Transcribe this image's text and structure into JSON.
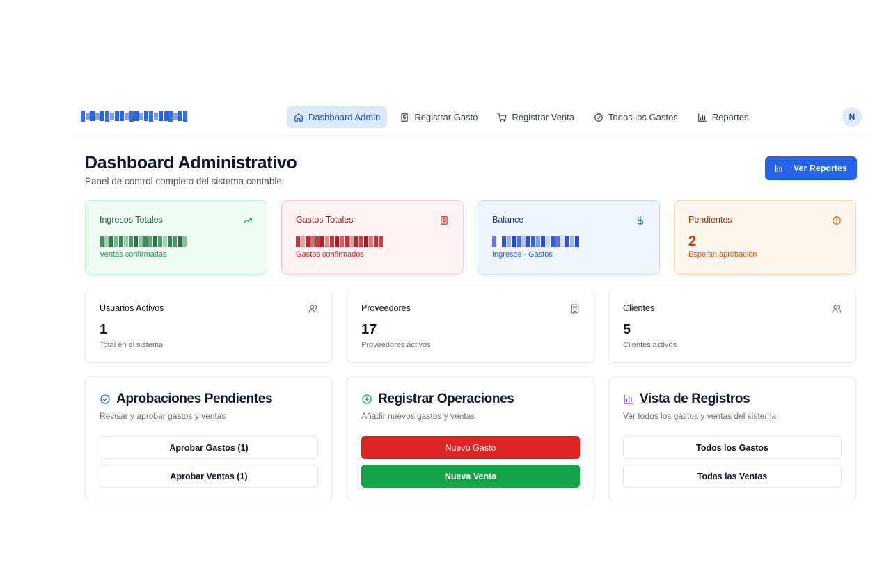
{
  "nav": {
    "brand": "Jasurfino Coroning",
    "links": [
      {
        "label": "Dashboard Admin",
        "icon": "home-icon",
        "active": true
      },
      {
        "label": "Registrar Gasto",
        "icon": "receipt-icon",
        "active": false
      },
      {
        "label": "Registrar Venta",
        "icon": "cart-icon",
        "active": false
      },
      {
        "label": "Todos los Gastos",
        "icon": "check-circle-icon",
        "active": false
      },
      {
        "label": "Reportes",
        "icon": "bar-chart-icon",
        "active": false
      }
    ],
    "avatar": "N"
  },
  "header": {
    "title": "Dashboard Administrativo",
    "subtitle": "Panel de control completo del sistema contable",
    "reports_button": "Ver Reportes"
  },
  "stats": [
    {
      "label": "Ingresos Totales",
      "value": "",
      "note": "Ventas confirmadas",
      "icon": "trending-up-icon",
      "color": "#16a34a"
    },
    {
      "label": "Gastos Totales",
      "value": "",
      "note": "Gastos confirmados",
      "icon": "receipt-icon",
      "color": "#dc2626"
    },
    {
      "label": "Balance",
      "value": "",
      "note": "Ingresos - Gastos",
      "icon": "dollar-icon",
      "color": "#2563eb"
    },
    {
      "label": "Pendientes",
      "value": "2",
      "note": "Esperan aprobación",
      "icon": "alert-circle-icon",
      "color": "#ea580c"
    }
  ],
  "infos": [
    {
      "label": "Usuarios Activos",
      "value": "1",
      "note": "Total en el sistema",
      "icon": "users-icon"
    },
    {
      "label": "Proveedores",
      "value": "17",
      "note": "Proveedores activos",
      "icon": "building-icon"
    },
    {
      "label": "Clientes",
      "value": "5",
      "note": "Clientes activos",
      "icon": "users-icon"
    }
  ],
  "actions": [
    {
      "title": "Aprobaciones Pendientes",
      "desc": "Revisar y aprobar gastos y ventas",
      "icon": "check-circle-icon",
      "color": "#2563eb",
      "buttons": [
        "Aprobar Gastos (1)",
        "Aprobar Ventas (1)"
      ]
    },
    {
      "title": "Registrar Operaciones",
      "desc": "Añadir nuevos gastos y ventas",
      "icon": "plus-circle-icon",
      "color": "#16a34a",
      "buttons": [
        "Nuevo Gasto",
        "Nueva Venta"
      ]
    },
    {
      "title": "Vista de Registros",
      "desc": "Ver todos los gastos y ventas del sistema",
      "icon": "bar-chart-icon",
      "color": "#9333ea",
      "buttons": [
        "Todos los Gastos",
        "Todas las Ventas"
      ]
    }
  ]
}
